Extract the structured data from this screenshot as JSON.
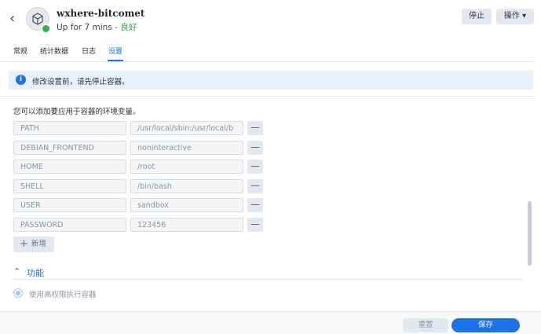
{
  "header": {
    "title": "wxhere-bitcomet",
    "status_prefix": "Up for 7 mins - ",
    "status_health": "良好",
    "stop_label": "停止",
    "action_label": "操作 ▾"
  },
  "tabs": [
    {
      "label": "常规"
    },
    {
      "label": "统计数据"
    },
    {
      "label": "日志"
    },
    {
      "label": "设置"
    }
  ],
  "notice": {
    "text": "修改设置前，请先停止容器。"
  },
  "env": {
    "description": "您可以添加要应用于容器的环境变量。",
    "rows": [
      {
        "key": "PATH",
        "value": "/usr/local/sbin:/usr/local/b"
      },
      {
        "key": "DEBIAN_FRONTEND",
        "value": "noninteractive"
      },
      {
        "key": "HOME",
        "value": "/root"
      },
      {
        "key": "SHELL",
        "value": "/bin/bash"
      },
      {
        "key": "USER",
        "value": "sandbox"
      },
      {
        "key": "PASSWORD",
        "value": "123456"
      }
    ],
    "add_label": "新增"
  },
  "features": {
    "title": "功能",
    "privileged_label": "使用高权限执行容器"
  },
  "footer": {
    "reset_label": "重置",
    "save_label": "保存"
  },
  "colors": {
    "accent": "#1a73e8",
    "status_good": "#2aa44a"
  },
  "icons": {
    "back": "back-arrow-icon",
    "container": "container-cube-icon",
    "info": "info-icon",
    "minus": "minus-icon",
    "plus": "plus-icon",
    "chevron": "chevron-up-icon"
  }
}
